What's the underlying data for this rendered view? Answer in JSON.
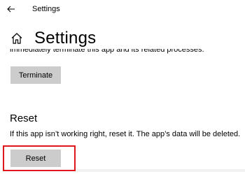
{
  "window": {
    "title": "Settings"
  },
  "header": {
    "page_title": "Settings"
  },
  "terminate_section": {
    "cut_text": "immediately terminate this app and its related processes.",
    "terminate_label": "Terminate"
  },
  "reset_section": {
    "heading": "Reset",
    "description": "If this app isn’t working right, reset it. The app’s data will be deleted.",
    "reset_label": "Reset"
  },
  "icons": {
    "back": "back-arrow-icon",
    "home": "home-icon"
  },
  "colors": {
    "button_bg": "#cccccc",
    "highlight": "#e0161d",
    "text": "#000000",
    "background": "#ffffff"
  }
}
